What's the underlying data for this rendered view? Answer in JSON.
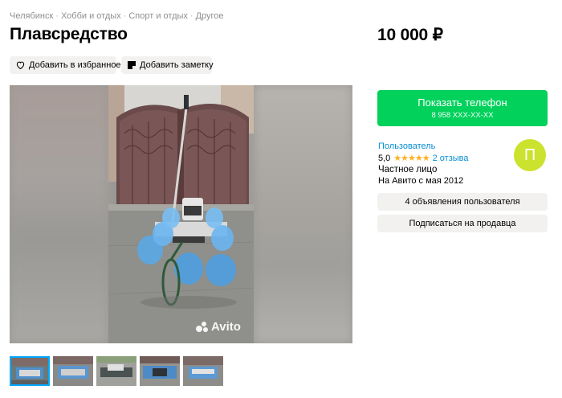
{
  "breadcrumb": [
    "Челябинск",
    "Хобби и отдых",
    "Спорт и отдых",
    "Другое"
  ],
  "breadcrumb_sep": "·",
  "title": "Плавсредство",
  "price": "10 000 ₽",
  "actions": {
    "favorite": "Добавить в избранное",
    "note": "Добавить заметку"
  },
  "gallery": {
    "watermark": "Avito",
    "thumb_count": 5,
    "active_thumb": 1
  },
  "contact": {
    "phone_button": "Показать телефон",
    "phone_masked": "8 958 XXX-XX-XX"
  },
  "seller": {
    "label": "Пользователь",
    "rating": "5,0",
    "stars": "★★★★★",
    "reviews": "2 отзыва",
    "type": "Частное лицо",
    "since": "На Авито с мая 2012",
    "avatar_letter": "П",
    "avatar_color": "#cbe22e"
  },
  "buttons": {
    "user_ads": "4 объявления пользователя",
    "subscribe": "Подписаться на продавца"
  },
  "colors": {
    "accent_green": "#02d15c",
    "link_blue": "#0a8fd1",
    "star": "#ffb021"
  }
}
